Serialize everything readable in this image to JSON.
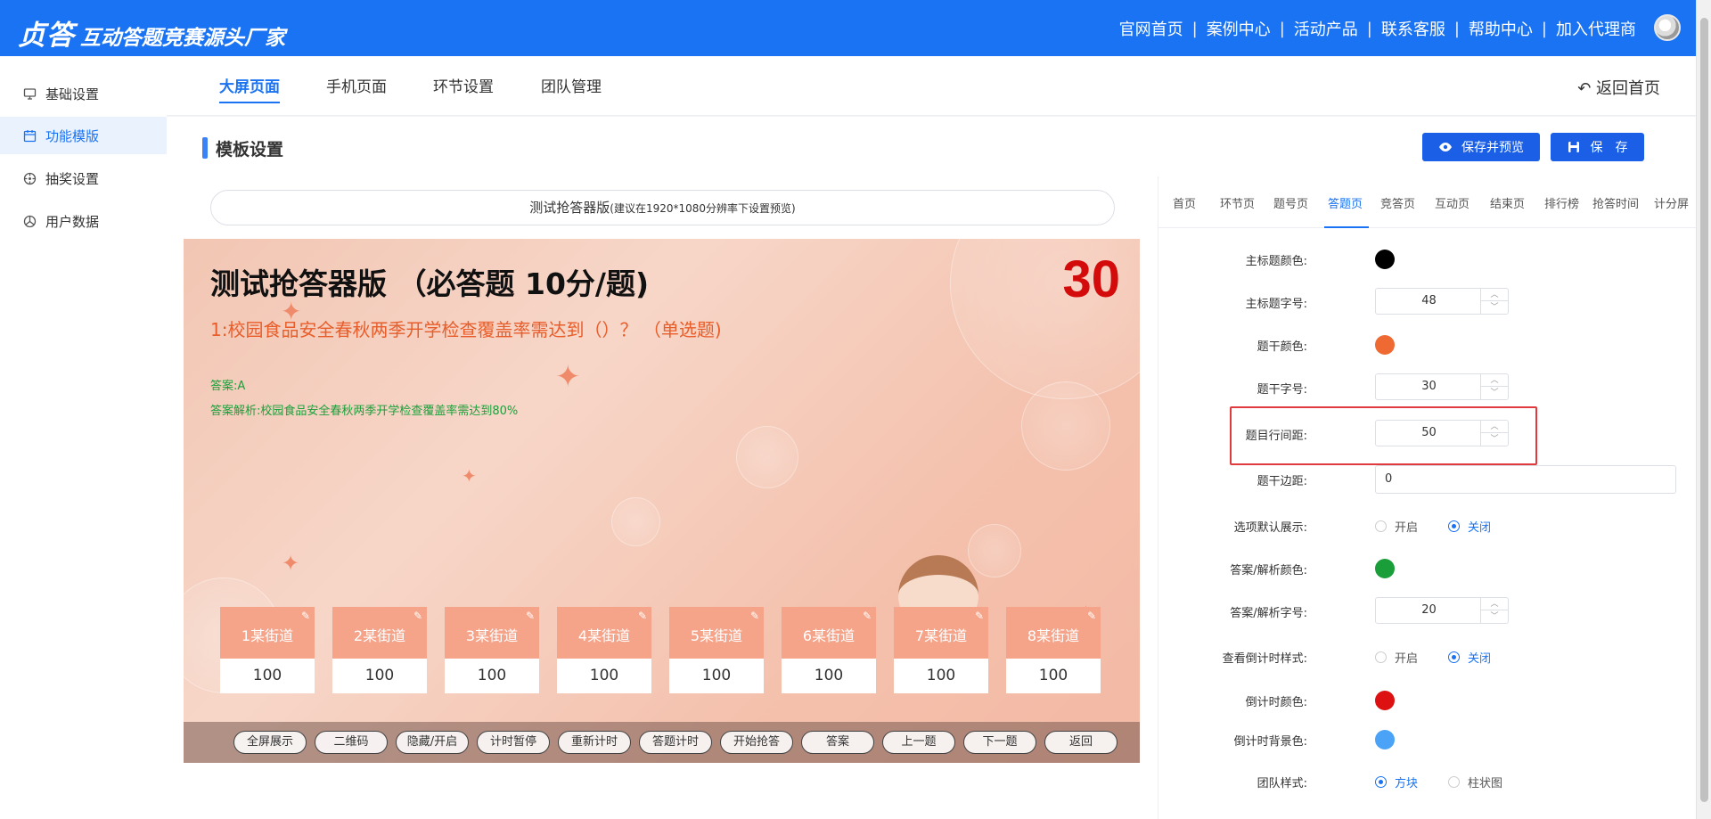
{
  "brand": {
    "mark": "贞答",
    "tagline": "互动答题竞赛源头厂家"
  },
  "topnav": [
    "官网首页",
    "案例中心",
    "活动产品",
    "联系客服",
    "帮助中心",
    "加入代理商"
  ],
  "sidebar": [
    {
      "label": "基础设置",
      "icon": "monitor-icon",
      "active": false
    },
    {
      "label": "功能模版",
      "icon": "calendar-icon",
      "active": true
    },
    {
      "label": "抽奖设置",
      "icon": "gift-icon",
      "active": false
    },
    {
      "label": "用户数据",
      "icon": "chart-icon",
      "active": false
    }
  ],
  "subnav": {
    "tabs": [
      "大屏页面",
      "手机页面",
      "环节设置",
      "团队管理"
    ],
    "active": 0,
    "back": "↶ 返回首页"
  },
  "section": {
    "title": "模板设置",
    "save_preview": "保存并预览",
    "save": "保　存"
  },
  "preview": {
    "name": "测试抢答器版",
    "hint": "(建议在1920*1080分辨率下设置预览)",
    "screen": {
      "title": "测试抢答器版 （必答题 10分/题)",
      "countdown": "30",
      "question": "1:校园食品安全春秋两季开学检查覆盖率需达到（）？ （单选题)",
      "answer": "答案:A",
      "analysis": "答案解析:校园食品安全春秋两季开学检查覆盖率需达到80%",
      "teams": [
        {
          "name": "1某街道",
          "score": "100"
        },
        {
          "name": "2某街道",
          "score": "100"
        },
        {
          "name": "3某街道",
          "score": "100"
        },
        {
          "name": "4某街道",
          "score": "100"
        },
        {
          "name": "5某街道",
          "score": "100"
        },
        {
          "name": "6某街道",
          "score": "100"
        },
        {
          "name": "7某街道",
          "score": "100"
        },
        {
          "name": "8某街道",
          "score": "100"
        }
      ],
      "controls": [
        "全屏展示",
        "二维码",
        "隐藏/开启",
        "计时暂停",
        "重新计时",
        "答题计时",
        "开始抢答",
        "答案",
        "上一题",
        "下一题",
        "返回"
      ]
    }
  },
  "settings": {
    "tabs": [
      "首页",
      "环节页",
      "题号页",
      "答题页",
      "竞答页",
      "互动页",
      "结束页",
      "排行榜",
      "抢答时间",
      "计分屏"
    ],
    "active_tab": 3,
    "rows": {
      "title_color": {
        "label": "主标题颜色:",
        "color": "#000000"
      },
      "title_size": {
        "label": "主标题字号:",
        "value": "48"
      },
      "stem_color": {
        "label": "题干颜色:",
        "color": "#ee6a32"
      },
      "stem_size": {
        "label": "题干字号:",
        "value": "30"
      },
      "line_spacing": {
        "label": "题目行间距:",
        "value": "50"
      },
      "stem_margin": {
        "label": "题干边距:",
        "value": "0"
      },
      "default_options": {
        "label": "选项默认展示:",
        "on": "开启",
        "off": "关闭",
        "selected": "off"
      },
      "answer_color": {
        "label": "答案/解析颜色:",
        "color": "#1a9e3a"
      },
      "answer_size": {
        "label": "答案/解析字号:",
        "value": "20"
      },
      "countdown_style": {
        "label": "查看倒计时样式:",
        "on": "开启",
        "off": "关闭",
        "selected": "off"
      },
      "countdown_color": {
        "label": "倒计时颜色:",
        "color": "#dd1111"
      },
      "countdown_bg": {
        "label": "倒计时背景色:",
        "color": "#4aa3f7"
      },
      "team_style": {
        "label": "团队样式:",
        "block": "方块",
        "bar": "柱状图",
        "selected": "block"
      }
    }
  }
}
